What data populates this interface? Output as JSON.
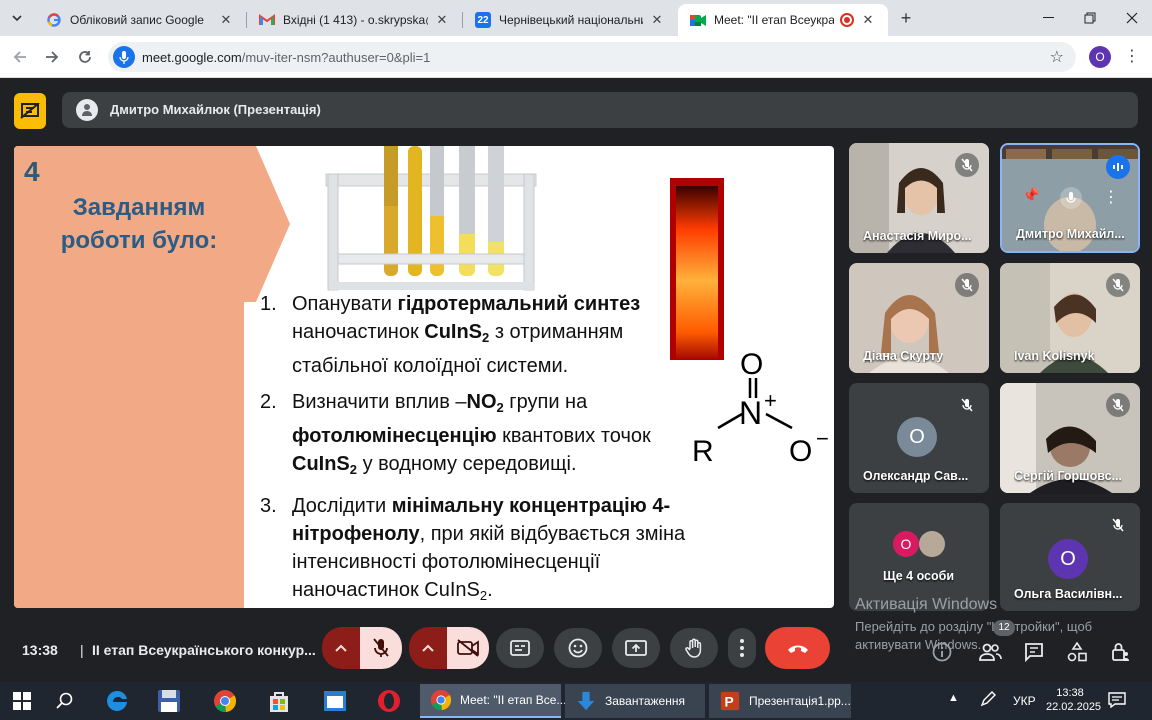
{
  "browser": {
    "tabs": [
      {
        "title": "Обліковий запис Google",
        "icon": "google-g-icon"
      },
      {
        "title": "Вхідні (1 413) - o.skrypska@chnu.edu.ua",
        "icon": "gmail-icon"
      },
      {
        "title": "Чернівецький національний університет",
        "icon": "calendar-icon"
      },
      {
        "title": "Meet: \"ІІ етап Всеукраїнського",
        "icon": "meet-icon"
      }
    ],
    "url_host": "meet.google.com",
    "url_path": "/muv-iter-nsm?authuser=0&pli=1",
    "profile_initial": "O"
  },
  "presenter": {
    "label": "Дмитро Михайлюк (Презентація)"
  },
  "slide": {
    "number": "4",
    "heading": "Завданням роботи було:",
    "items": [
      {
        "num": "1.",
        "parts": [
          [
            "t",
            "Опанувати "
          ],
          [
            "b",
            "гідротермальний синтез"
          ],
          [
            "t",
            " наночастинок "
          ],
          [
            "b",
            "CuInS"
          ],
          [
            "bs",
            "2"
          ],
          [
            "t",
            " з отриманням стабільної колоїдної системи."
          ]
        ]
      },
      {
        "num": "2.",
        "parts": [
          [
            "t",
            "Визначити вплив –"
          ],
          [
            "b",
            "NO"
          ],
          [
            "bs",
            "2"
          ],
          [
            "t",
            " групи на "
          ],
          [
            "b",
            "фотолюмінесценцію"
          ],
          [
            "t",
            " квантових точок "
          ],
          [
            "b",
            "CuInS"
          ],
          [
            "bs",
            "2"
          ],
          [
            "t",
            " у водному середовищі."
          ]
        ]
      },
      {
        "num": "3.",
        "parts": [
          [
            "t",
            "Дослідити "
          ],
          [
            "b",
            "мінімальну концентрацію 4-нітрофенолу"
          ],
          [
            "t",
            ", при якій відбувається зміна інтенсивності фотолюмінесценції наночастинок CuInS"
          ],
          [
            "ts",
            "2"
          ],
          [
            "t",
            "."
          ]
        ]
      }
    ],
    "formula": {
      "R": "R",
      "N": "N",
      "plus": "+",
      "O_top": "O",
      "O_right": "O",
      "minus": "−"
    }
  },
  "participants": [
    {
      "name": "Анастасія Миро...",
      "muted": true,
      "speaking": false
    },
    {
      "name": "Дмитро Михайл...",
      "muted": false,
      "speaking": true
    },
    {
      "name": "Діана Скурту",
      "muted": true,
      "speaking": false
    },
    {
      "name": "Ivan Kolisnyk",
      "muted": true,
      "speaking": false
    },
    {
      "name": "Олександр Сав...",
      "muted": true,
      "speaking": false,
      "initial": "O",
      "avatar_color": "#7a8a99"
    },
    {
      "name": "Сергій Горшовс...",
      "muted": true,
      "speaking": false
    },
    {
      "name": "Ще 4 особи",
      "initial": "O",
      "avatar_color": "#d81b60"
    },
    {
      "name": "Ольга Василівн...",
      "muted": true,
      "initial": "O",
      "avatar_color": "#5e35b1"
    }
  ],
  "watermark": {
    "title": "Активація Windows",
    "line1": "Перейдіть до розділу \"Настройки\", щоб",
    "line2": "активувати Windows."
  },
  "meeting_bar": {
    "time": "13:38",
    "separator": "|",
    "meeting_name": "ІІ етап Всеукраїнського конкур...",
    "participants_badge": "12"
  },
  "taskbar": {
    "apps": [
      {
        "label": "Meet: \"ІІ етап Все...",
        "active": true
      },
      {
        "label": "Завантаження",
        "active": false
      },
      {
        "label": "Презентація1.pp...",
        "active": false
      }
    ],
    "lang": "УКР",
    "time": "13:38",
    "date": "22.02.2025"
  },
  "colors": {
    "accent_blue": "#1a73e8",
    "leave_red": "#ea4335",
    "present_yellow": "#fbbc04",
    "slide_peach": "#f2a986",
    "slide_heading": "#2a5c85"
  }
}
